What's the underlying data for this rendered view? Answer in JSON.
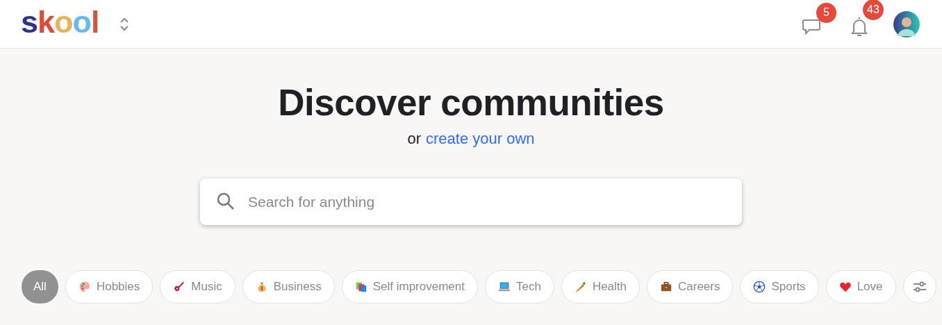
{
  "header": {
    "logo": "skool",
    "messages_badge": "5",
    "notifications_badge": "43"
  },
  "hero": {
    "title": "Discover communities",
    "subtitle_prefix": "or",
    "subtitle_link": "create your own"
  },
  "search": {
    "placeholder": "Search for anything"
  },
  "categories": [
    {
      "label": "All",
      "selected": true
    },
    {
      "label": "Hobbies",
      "selected": false
    },
    {
      "label": "Music",
      "selected": false
    },
    {
      "label": "Business",
      "selected": false
    },
    {
      "label": "Self improvement",
      "selected": false
    },
    {
      "label": "Tech",
      "selected": false
    },
    {
      "label": "Health",
      "selected": false
    },
    {
      "label": "Careers",
      "selected": false
    },
    {
      "label": "Sports",
      "selected": false
    },
    {
      "label": "Love",
      "selected": false
    }
  ]
}
